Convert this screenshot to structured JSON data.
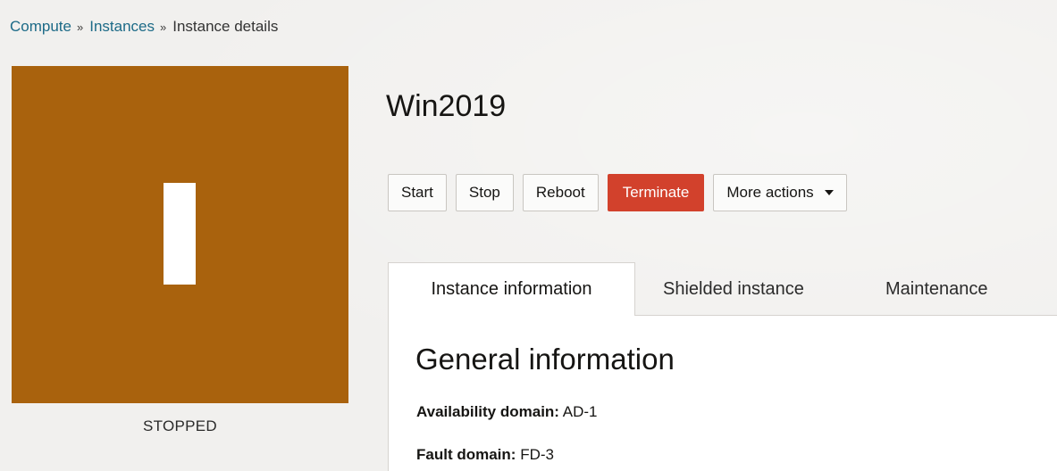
{
  "breadcrumb": {
    "items": [
      "Compute",
      "Instances"
    ],
    "separator": "»",
    "current": "Instance details"
  },
  "instance": {
    "state": "STOPPED",
    "state_color": "#a9620d",
    "state_icon": "stopped-bar-icon",
    "name": "Win2019"
  },
  "actions": {
    "start": "Start",
    "stop": "Stop",
    "reboot": "Reboot",
    "terminate": "Terminate",
    "more": "More actions",
    "terminate_color": "#d2412c"
  },
  "tabs": [
    {
      "label": "Instance information",
      "active": true
    },
    {
      "label": "Shielded instance",
      "active": false
    },
    {
      "label": "Maintenance",
      "active": false
    }
  ],
  "general": {
    "title": "General information",
    "fields": [
      {
        "label": "Availability domain:",
        "value": "AD-1"
      },
      {
        "label": "Fault domain:",
        "value": "FD-3"
      }
    ]
  }
}
